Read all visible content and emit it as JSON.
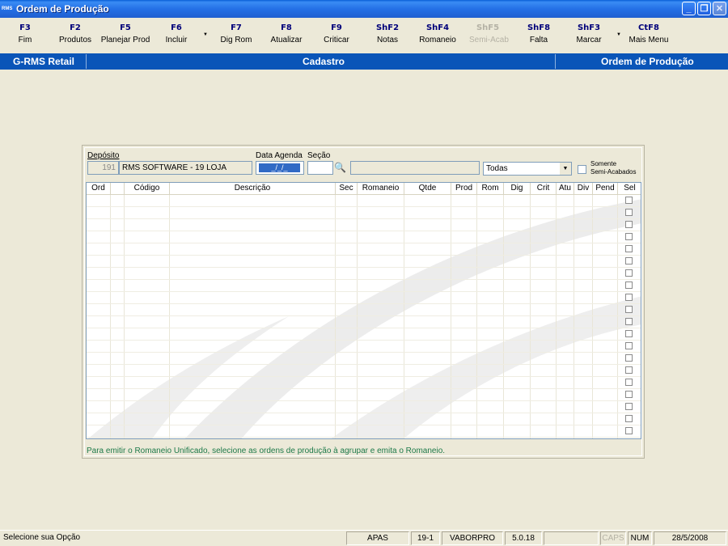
{
  "window": {
    "title": "Ordem de Produção",
    "icon_text": "RMS"
  },
  "toolbar": {
    "items": [
      {
        "key": "F3",
        "label": "Fim"
      },
      {
        "key": "F2",
        "label": "Produtos"
      },
      {
        "key": "F5",
        "label": "Planejar Prod"
      },
      {
        "key": "F6",
        "label": "Incluir"
      },
      {
        "key": "F7",
        "label": "Dig Rom"
      },
      {
        "key": "F8",
        "label": "Atualizar"
      },
      {
        "key": "F9",
        "label": "Criticar"
      },
      {
        "key": "ShF2",
        "label": "Notas"
      },
      {
        "key": "ShF4",
        "label": "Romaneio"
      },
      {
        "key": "ShF5",
        "label": "Semi-Acab"
      },
      {
        "key": "ShF8",
        "label": "Falta"
      },
      {
        "key": "ShF3",
        "label": "Marcar"
      },
      {
        "key": "CtF8",
        "label": "Mais Menu"
      }
    ]
  },
  "infobar": {
    "left": "G-RMS Retail",
    "center": "Cadastro",
    "right": "Ordem de Produção"
  },
  "filters": {
    "deposito_label": "Depósito",
    "deposito_code": "191",
    "deposito_name": "RMS SOFTWARE  - 19 LOJA",
    "data_agenda_label": "Data Agenda",
    "data_agenda_value": "_/_/_",
    "secao_label": "Seção",
    "secao_value": "",
    "secao_desc": "",
    "status_select": "Todas",
    "somente_label_1": "Somente",
    "somente_label_2": "Semi-Acabados"
  },
  "grid": {
    "columns": [
      "Ord",
      "",
      "Código",
      "Descrição",
      "Sec",
      "Romaneio",
      "Qtde",
      "Prod",
      "Rom",
      "Dig",
      "Crit",
      "Atu",
      "Div",
      "Pend",
      "Sel"
    ]
  },
  "hint": "Para emitir o Romaneio Unificado, selecione as ordens de produção à agrupar e emita o Romaneio.",
  "status": {
    "message": "Selecione sua Opção",
    "company": "APAS",
    "code": "19-1",
    "program": "VABORPRO",
    "version": "5.0.18",
    "caps": "CAPS",
    "num": "NUM",
    "date": "28/5/2008"
  }
}
